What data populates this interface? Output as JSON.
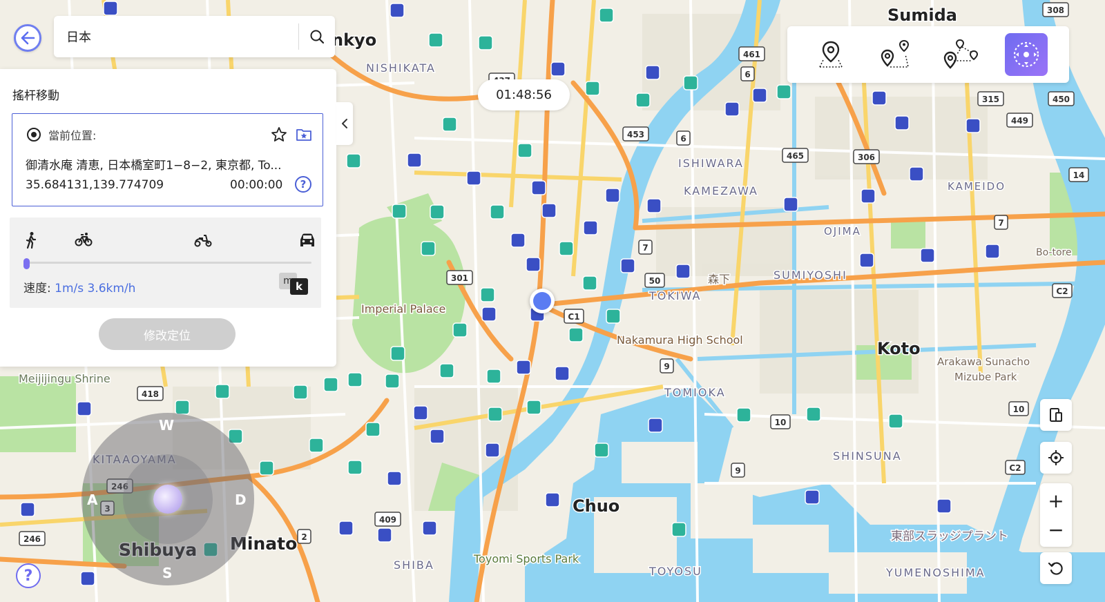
{
  "search": {
    "value": "日本"
  },
  "panel": {
    "title": "搖杆移動",
    "current_label": "當前位置:",
    "address": "御清水庵 清恵, 日本橋室町1−8−2, 東京都, To...",
    "coordinates": "35.684131,139.774709",
    "elapsed": "00:00:00",
    "help_glyph": "?"
  },
  "speed": {
    "label": "速度:",
    "value": "1m/s 3.6km/h",
    "level": 0,
    "unit_m": "m",
    "unit_k": "k",
    "modes": [
      "walk-icon",
      "bike-icon",
      "scooter-icon",
      "car-icon"
    ]
  },
  "modify_button": "修改定位",
  "timer": "01:48:56",
  "joystick": {
    "up": "W",
    "down": "S",
    "left": "A",
    "right": "D"
  },
  "zoom": {
    "in": "+",
    "out": "−"
  },
  "help": "?",
  "colors": {
    "accent": "#6f6cf0",
    "card_border": "#4a5fd6",
    "water": "#8fd3f2",
    "park": "#b9e3a3",
    "major_road": "#f7a14a"
  },
  "map": {
    "districts": [
      {
        "text": "Sumida"
      },
      {
        "text": "nkyo"
      },
      {
        "text": "NISHIKATA"
      },
      {
        "text": "ISHIWARA"
      },
      {
        "text": "KAMEZAWA"
      },
      {
        "text": "KAMEIDO"
      },
      {
        "text": "OJIMA"
      },
      {
        "text": "Bo-tore"
      },
      {
        "text": "SUMIYOSHI"
      },
      {
        "text": "森下"
      },
      {
        "text": "TOKIWA"
      },
      {
        "text": "Imperial Palace"
      },
      {
        "text": "Nakamura High School"
      },
      {
        "text": "Koto"
      },
      {
        "text": "Arakawa Sunacho"
      },
      {
        "text": "Mizube Park"
      },
      {
        "text": "TOMIOKA"
      },
      {
        "text": "SHINSUNA"
      },
      {
        "text": "Meijijingu Shrine"
      },
      {
        "text": "KITAAOYAMA"
      },
      {
        "text": "Shibuya"
      },
      {
        "text": "Minato"
      },
      {
        "text": "Chuo"
      },
      {
        "text": "SHIBA"
      },
      {
        "text": "Toyomi Sports Park"
      },
      {
        "text": "TOYOSU"
      },
      {
        "text": "東部スラッジプラント"
      },
      {
        "text": "YUMENOSHIMA"
      }
    ],
    "shields": [
      {
        "text": "308"
      },
      {
        "text": "461"
      },
      {
        "text": "6"
      },
      {
        "text": "437"
      },
      {
        "text": "453"
      },
      {
        "text": "6"
      },
      {
        "text": "465"
      },
      {
        "text": "306"
      },
      {
        "text": "315"
      },
      {
        "text": "450"
      },
      {
        "text": "449"
      },
      {
        "text": "7"
      },
      {
        "text": "7"
      },
      {
        "text": "301"
      },
      {
        "text": "50"
      },
      {
        "text": "C1"
      },
      {
        "text": "9"
      },
      {
        "text": "418"
      },
      {
        "text": "246"
      },
      {
        "text": "3"
      },
      {
        "text": "10"
      },
      {
        "text": "10"
      },
      {
        "text": "9"
      },
      {
        "text": "C2"
      },
      {
        "text": "C2"
      },
      {
        "text": "409"
      },
      {
        "text": "2"
      },
      {
        "text": "246"
      },
      {
        "text": "14"
      }
    ]
  }
}
